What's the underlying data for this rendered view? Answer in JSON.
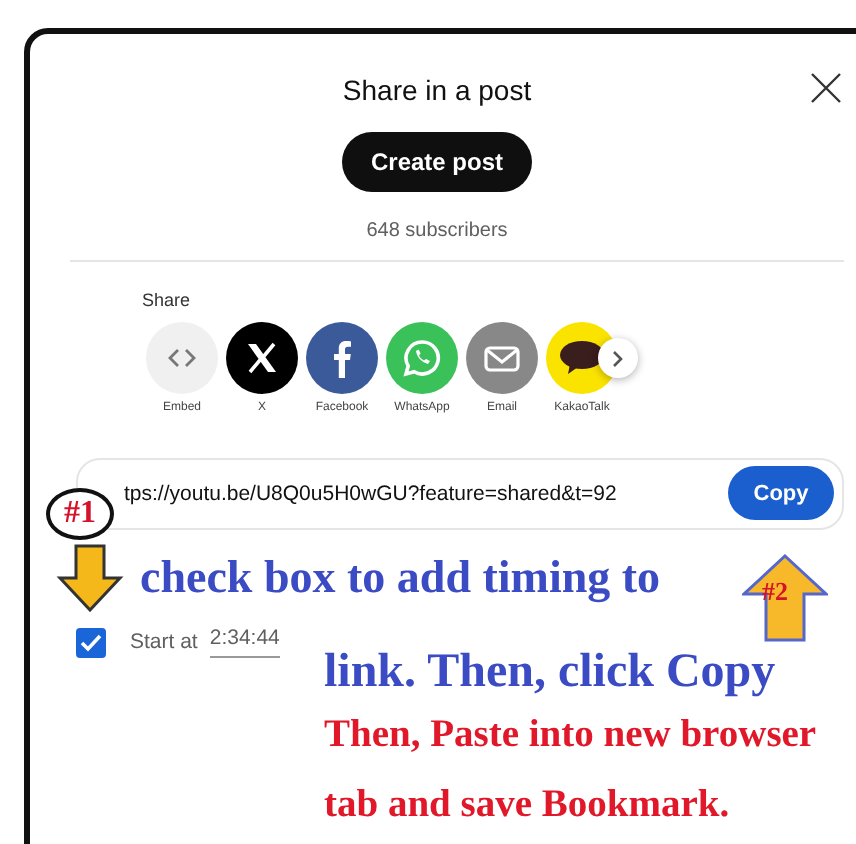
{
  "dialog": {
    "title": "Share in a post",
    "create_post_button": "Create post",
    "subscribers": "648 subscribers",
    "share_label": "Share",
    "share_targets": [
      {
        "label": "Embed",
        "kind": "embed"
      },
      {
        "label": "X",
        "kind": "x"
      },
      {
        "label": "Facebook",
        "kind": "facebook"
      },
      {
        "label": "WhatsApp",
        "kind": "whatsapp"
      },
      {
        "label": "Email",
        "kind": "email"
      },
      {
        "label": "KakaoTalk",
        "kind": "kakaotalk"
      }
    ],
    "link": "tps://youtu.be/U8Q0u5H0wGU?feature=shared&t=92",
    "copy_button": "Copy",
    "start_at": {
      "label": "Start at",
      "time": "2:34:44",
      "checked": true
    }
  },
  "annotations": {
    "marker_1": "#1",
    "marker_2": "#2",
    "lines": [
      {
        "text": "check box to add timing to",
        "color": "#3a4bc4"
      },
      {
        "text": "link. Then, click Copy",
        "color": "#3a4bc4"
      },
      {
        "text": "Then, Paste into new browser",
        "color": "#e0182a"
      },
      {
        "text": "tab and save Bookmark.",
        "color": "#e0182a"
      }
    ]
  }
}
